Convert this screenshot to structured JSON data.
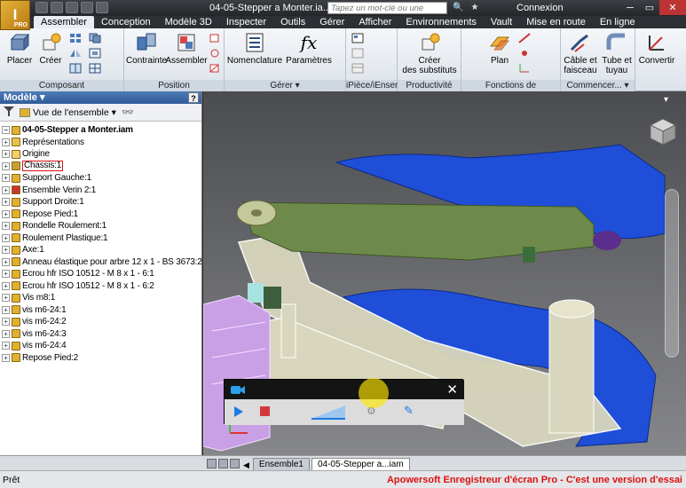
{
  "app": {
    "logo_text": "I",
    "logo_sub": "PRO"
  },
  "window": {
    "doc_title": "04-05-Stepper a Monter.ia...",
    "search_placeholder": "Tapez un mot-clé ou une expression",
    "connexion": "Connexion"
  },
  "tabs": [
    "Assembler",
    "Conception",
    "Modèle 3D",
    "Inspecter",
    "Outils",
    "Gérer",
    "Afficher",
    "Environnements",
    "Vault",
    "Mise en route",
    "En ligne"
  ],
  "active_tab": 0,
  "ribbon": {
    "groups": {
      "composant": "Composant",
      "position": "Position",
      "gerer": "Gérer ▾",
      "ipiece": "iPièce/iEnsemble",
      "productivite": "Productivité",
      "fonctions": "Fonctions de construction",
      "commencer": "Commencer... ▾"
    },
    "buttons": {
      "placer": "Placer",
      "creer": "Créer",
      "contrainte": "Contrainte",
      "assembler": "Assembler",
      "nomenclature": "Nomenclature",
      "parametres": "Paramètres",
      "creer_substituts_1": "Créer",
      "creer_substituts_2": "des substituts",
      "plan": "Plan",
      "cable_1": "Câble et",
      "cable_2": "faisceau",
      "tube_1": "Tube et",
      "tube_2": "tuyau",
      "convertir": "Convertir"
    }
  },
  "panel": {
    "title": "Modèle ▾",
    "help": "?",
    "view_label": "Vue de l'ensemble",
    "tree": [
      {
        "label": "04-05-Stepper a Monter.iam",
        "root": true,
        "color": "#e0b030"
      },
      {
        "label": "Représentations",
        "color": "#e8c050"
      },
      {
        "label": "Origine",
        "color": "#f0d070"
      },
      {
        "label": "Chassis:1",
        "color": "#c9a030",
        "highlight": true
      },
      {
        "label": "Support Gauche:1",
        "color": "#e0b030"
      },
      {
        "label": "Ensemble Verin 2:1",
        "color": "#cc3333"
      },
      {
        "label": "Support Droite:1",
        "color": "#e0b030"
      },
      {
        "label": "Repose Pied:1",
        "color": "#e0b030"
      },
      {
        "label": "Rondelle Roulement:1",
        "color": "#e0b030"
      },
      {
        "label": "Roulement Plastique:1",
        "color": "#e0b030"
      },
      {
        "label": "Axe:1",
        "color": "#e0b030"
      },
      {
        "label": "Anneau élastique pour arbre 12 x 1 - BS 3673:2",
        "color": "#e0b030"
      },
      {
        "label": "Ecrou hfr  ISO 10512 - M 8 x 1 - 6:1",
        "color": "#e0b030"
      },
      {
        "label": "Ecrou hfr  ISO 10512 - M 8 x 1 - 6:2",
        "color": "#e0b030"
      },
      {
        "label": "Vis m8:1",
        "color": "#e0b030"
      },
      {
        "label": "vis m6-24:1",
        "color": "#e0b030"
      },
      {
        "label": "vis m6-24:2",
        "color": "#e0b030"
      },
      {
        "label": "vis m6-24:3",
        "color": "#e0b030"
      },
      {
        "label": "vis m6-24:4",
        "color": "#e0b030"
      },
      {
        "label": "Repose Pied:2",
        "color": "#e0b030"
      }
    ]
  },
  "doc_tabs": [
    {
      "label": "Ensemble1",
      "active": false
    },
    {
      "label": "04-05-Stepper a...iam",
      "active": true
    }
  ],
  "status": {
    "text": "Prêt",
    "watermark": "Apowersoft Enregistreur d'écran Pro - C'est une version d'essai"
  },
  "colors": {
    "blue_part": "#1f4fd8",
    "green_part": "#6e8a4a",
    "pink_part": "#c9a0e6",
    "beige_part": "#d8d6bc"
  }
}
